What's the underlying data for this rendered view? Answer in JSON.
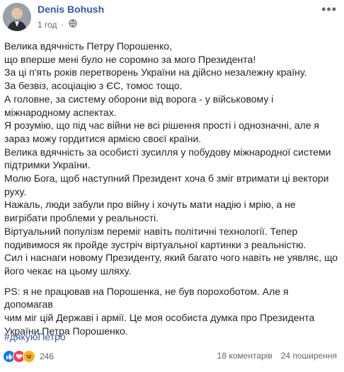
{
  "header": {
    "author_name": "Denis Bohush",
    "time": "1 год",
    "privacy_icon": "globe-icon",
    "more_icon": "more-options-icon"
  },
  "post": {
    "lines": [
      "Велика вдячність Петру Порошенко,",
      "що вперше мені було не соромно за мого Президента!",
      "За ці п'ять років перетворень України на дійсно незалежну країну.",
      "За безвіз, асоціацію з ЄС, томос тощо.",
      "А головне, за систему оборони від ворога - у військовому і",
      "міжнародному аспектах.",
      "Я розумію, що під час війни не всі рішення прості і однозначні, але я",
      "зараз можу гордитися армією своєї країни.",
      "Велика вдячність за особисті зусилля у побудову міжнародної системи",
      "підтримки України.",
      "Молю Бога, щоб наступний Президент хоча б зміг втримати ці вектори",
      "руху.",
      "Нажаль, люди забули про війну і хочуть мати надію і мрію, а не",
      "вигрібати проблеми у реальності.",
      "Віртуальний популізм переміг навіть політичні технології. Тепер",
      "подивимося як пройде зустріч віртуальної картинки з реальністю.",
      "Сил і наснаги новому Президенту, який багато чого навіть не уявляє, що",
      "його чекає на цьому шляху."
    ],
    "ps_lines": [
      "PS: я не працював на Порошенка, не був порохоботом. Але я допомагав",
      "чим міг цій Державі і армії. Це моя особиста думка про Президента",
      "України Петра Порошенко."
    ],
    "hashtag": "#дякуюПетро"
  },
  "footer": {
    "reaction_icons": [
      "like-icon",
      "love-icon",
      "haha-icon"
    ],
    "reaction_count": "246",
    "comments": "18 коментарів",
    "shares": "24 поширення"
  }
}
